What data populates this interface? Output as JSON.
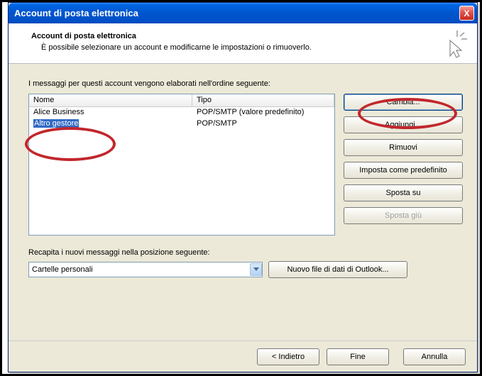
{
  "window": {
    "title": "Account di posta elettronica",
    "close_glyph": "X"
  },
  "header": {
    "title": "Account di posta elettronica",
    "subtitle": "È possibile selezionare un account e modificarne le impostazioni o rimuoverlo."
  },
  "body": {
    "intro": "I messaggi per questi account vengono elaborati nell'ordine seguente:",
    "columns": {
      "name": "Nome",
      "type": "Tipo"
    },
    "rows": [
      {
        "name": "Alice Business",
        "type": "POP/SMTP (valore predefinito)",
        "selected": false
      },
      {
        "name": "Altro gestore",
        "type": "POP/SMTP",
        "selected": true
      }
    ],
    "buttons": {
      "change": "Cambia...",
      "add": "Aggiungi...",
      "remove": "Rimuovi",
      "set_default": "Imposta come predefinito",
      "move_up": "Sposta su",
      "move_down": "Sposta giù"
    },
    "deliver_label": "Recapita i nuovi messaggi nella posizione seguente:",
    "deliver_combo": "Cartelle personali",
    "new_datafile": "Nuovo file di dati di Outlook..."
  },
  "footer": {
    "back": "< Indietro",
    "finish": "Fine",
    "cancel": "Annulla"
  }
}
